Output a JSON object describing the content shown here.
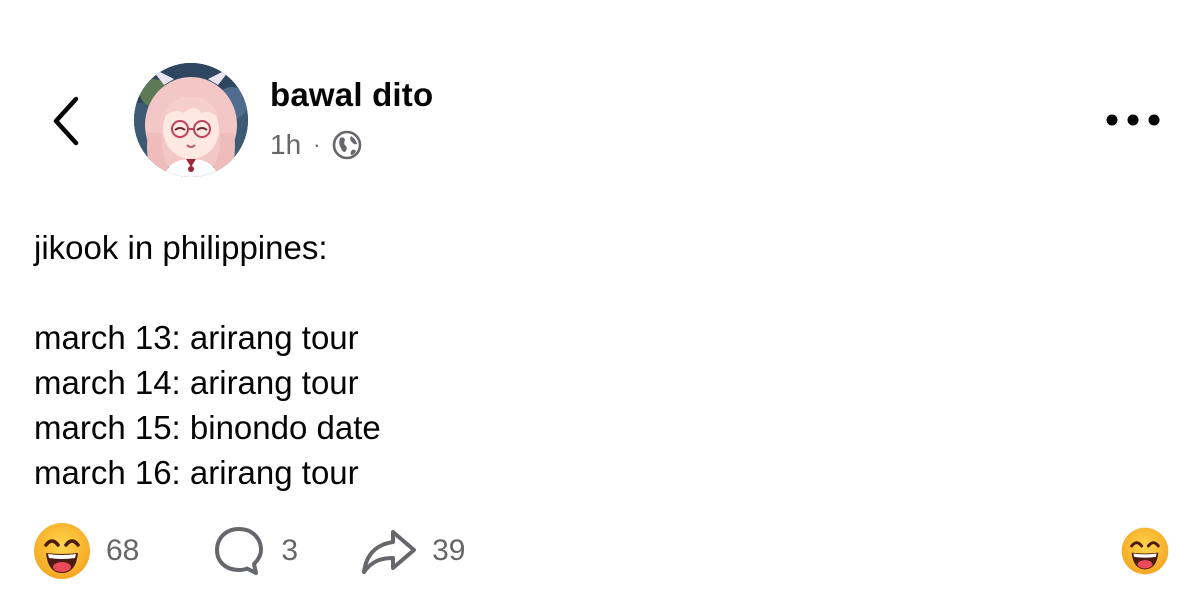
{
  "header": {
    "author_name": "bawal dito",
    "timestamp": "1h",
    "separator": "·",
    "audience_icon": "globe-icon"
  },
  "post": {
    "intro": "jikook in philippines:",
    "lines": [
      "march 13: arirang tour",
      "march 14: arirang tour",
      "march 15: binondo date",
      "march 16: arirang tour"
    ]
  },
  "actions": {
    "reaction_icon": "laughing-emoji-icon",
    "reaction_count": "68",
    "comment_icon": "comment-bubble-icon",
    "comment_count": "3",
    "share_icon": "share-arrow-icon",
    "share_count": "39"
  },
  "colors": {
    "text": "#050505",
    "muted": "#65676b",
    "emoji_yellow": "#f7b125",
    "emoji_mouth": "#4b1a10"
  }
}
